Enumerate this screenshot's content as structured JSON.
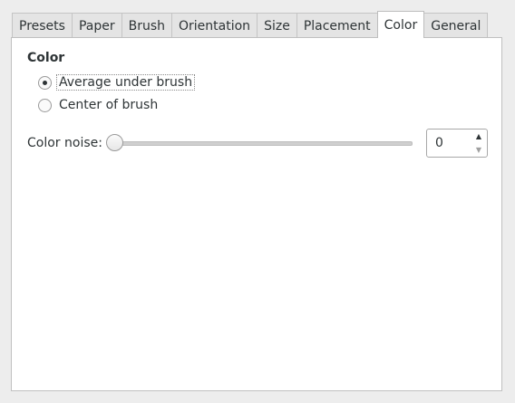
{
  "tabs": [
    {
      "label": "Presets"
    },
    {
      "label": "Paper"
    },
    {
      "label": "Brush"
    },
    {
      "label": "Orientation"
    },
    {
      "label": "Size"
    },
    {
      "label": "Placement"
    },
    {
      "label": "Color"
    },
    {
      "label": "General"
    }
  ],
  "active_tab": "Color",
  "color_section": {
    "title": "Color",
    "options": [
      {
        "label": "Average under brush",
        "selected": true
      },
      {
        "label": "Center of brush",
        "selected": false
      }
    ]
  },
  "color_noise": {
    "label": "Color noise:",
    "value": "0",
    "slider_fraction": 0,
    "up_icon": "triangle-up-icon",
    "down_icon": "triangle-down-icon"
  }
}
